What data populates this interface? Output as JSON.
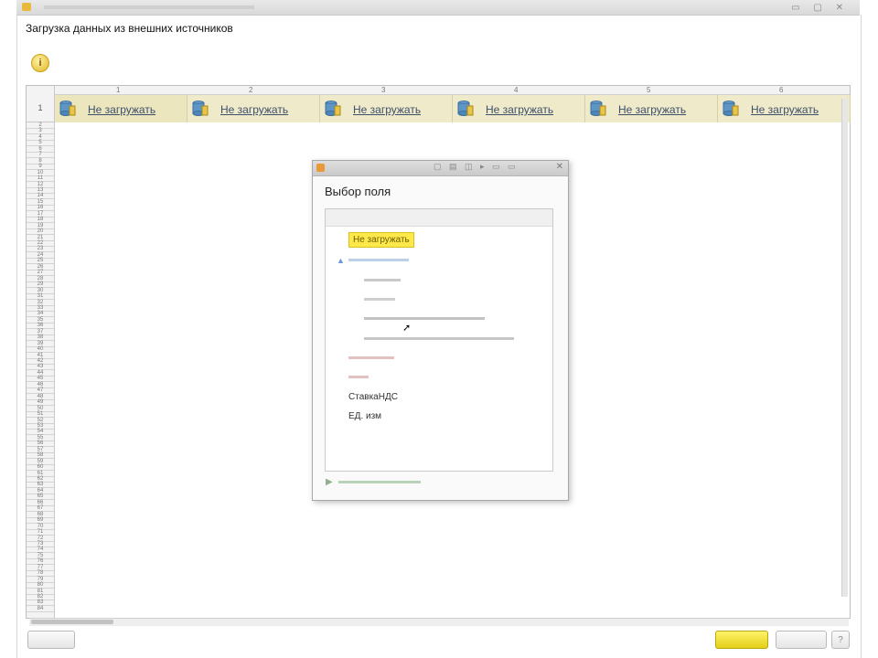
{
  "window": {
    "title": "Загрузка данных из внешних источников"
  },
  "grid": {
    "column_numbers": [
      "1",
      "2",
      "3",
      "4",
      "5",
      "6"
    ],
    "first_row_number": "1",
    "row_numbers": [
      "2",
      "3",
      "4",
      "5",
      "6",
      "7",
      "8",
      "9",
      "10",
      "11",
      "12",
      "13",
      "14",
      "15",
      "16",
      "17",
      "18",
      "19",
      "20",
      "21",
      "22",
      "23",
      "24",
      "25",
      "26",
      "27",
      "28",
      "29",
      "30",
      "31",
      "32",
      "33",
      "34",
      "35",
      "36",
      "37",
      "38",
      "39",
      "40",
      "41",
      "42",
      "43",
      "44",
      "45",
      "46",
      "47",
      "48",
      "49",
      "50",
      "51",
      "52",
      "53",
      "54",
      "55",
      "56",
      "57",
      "58",
      "59",
      "60",
      "61",
      "62",
      "63",
      "64",
      "65",
      "66",
      "67",
      "68",
      "69",
      "70",
      "71",
      "72",
      "73",
      "74",
      "75",
      "76",
      "77",
      "78",
      "79",
      "80",
      "81",
      "82",
      "83",
      "84"
    ],
    "cells": [
      {
        "label": "Не загружать"
      },
      {
        "label": "Не загружать"
      },
      {
        "label": "Не загружать"
      },
      {
        "label": "Не загружать"
      },
      {
        "label": "Не загружать"
      },
      {
        "label": "Не загружать"
      }
    ]
  },
  "popup": {
    "heading": "Выбор поля",
    "selected_item": "Не загружать",
    "fields": [
      {
        "label": "СтавкаНДС",
        "kind": "dark"
      },
      {
        "label": "ЕД. изм",
        "kind": "dark"
      }
    ]
  },
  "colors": {
    "highlight": "#ffe94a",
    "cell_background": "#efeac9",
    "link_text": "#3d4f6b"
  }
}
